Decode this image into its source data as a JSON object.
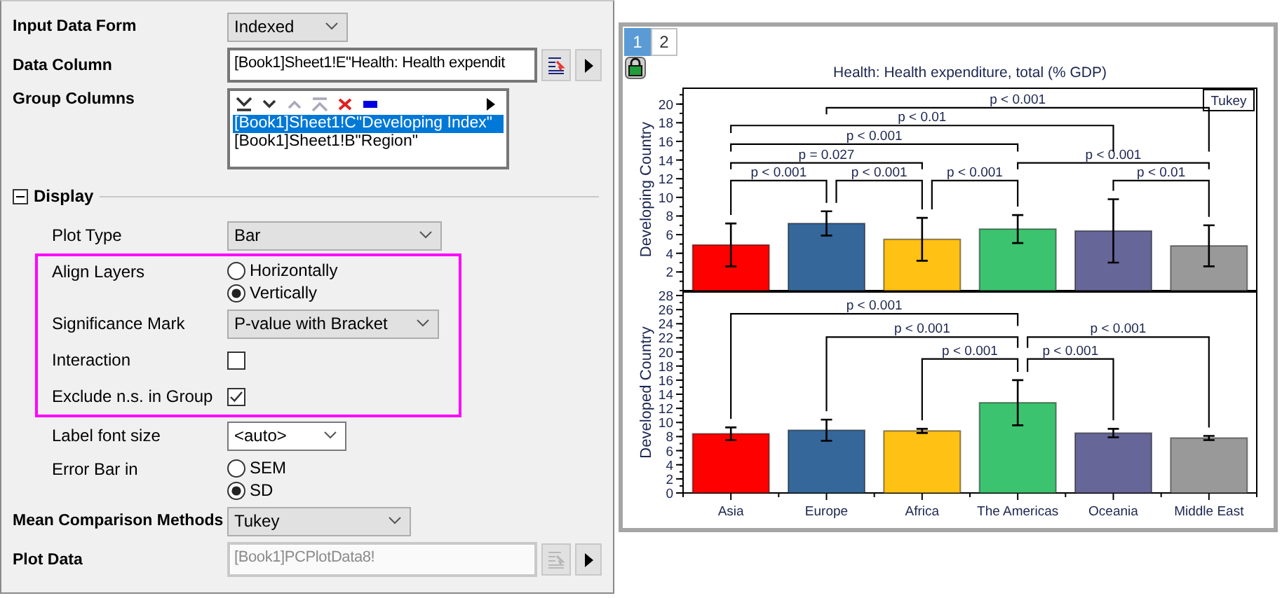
{
  "settings": [
    {
      "kind": "dropdown",
      "label": "Input Data Form",
      "value": "Indexed",
      "editable": false
    },
    {
      "kind": "field",
      "label": "Data Column",
      "value": "[Book1]Sheet1!E\"Health: Health expendit",
      "disabled": false
    },
    {
      "kind": "list",
      "label": "Group Columns",
      "tools": [
        {
          "kind": "bottom",
          "disabled": false
        },
        {
          "kind": "down",
          "disabled": false
        },
        {
          "kind": "up",
          "disabled": true
        },
        {
          "kind": "top",
          "disabled": true
        },
        {
          "kind": "delete",
          "disabled": false
        },
        {
          "kind": "rect",
          "disabled": false
        },
        {
          "kind": "more",
          "disabled": false
        }
      ],
      "items": [
        {
          "label": "[Book1]Sheet1!C\"Developing Index\"",
          "selected": true
        },
        {
          "label": "[Book1]Sheet1!B\"Region\"",
          "selected": false
        }
      ]
    },
    {
      "kind": "section",
      "label": "Display",
      "expanded": true,
      "children": [
        {
          "kind": "dropdown",
          "label": "Plot Type",
          "value": "Bar",
          "editable": false
        },
        {
          "kind": "group",
          "highlighted": true,
          "children": [
            {
              "kind": "radio",
              "label": "Align Layers",
              "options": [
                {
                  "label": "Horizontally",
                  "selected": false
                },
                {
                  "label": "Vertically",
                  "selected": true
                }
              ]
            },
            {
              "kind": "dropdown",
              "label": "Significance Mark",
              "value": "P-value with Bracket",
              "editable": false
            },
            {
              "kind": "checkbox",
              "label": "Interaction",
              "checked": false
            },
            {
              "kind": "checkbox",
              "label": "Exclude n.s. in Group",
              "checked": true
            }
          ]
        },
        {
          "kind": "dropdown",
          "label": "Label font size",
          "value": "<auto>",
          "editable": true
        },
        {
          "kind": "radio",
          "label": "Error Bar in",
          "options": [
            {
              "label": "SEM",
              "selected": false
            },
            {
              "label": "SD",
              "selected": true
            }
          ]
        }
      ]
    },
    {
      "kind": "dropdown",
      "label": "Mean Comparison Methods",
      "value": "Tukey",
      "editable": false
    },
    {
      "kind": "field",
      "label": "Plot Data",
      "value": "[Book1]PCPlotData8!",
      "disabled": true
    }
  ],
  "graph": {
    "tabs": [
      {
        "label": "1",
        "selected": true
      },
      {
        "label": "2",
        "selected": false
      }
    ],
    "charts": [
      {
        "legend": "Tukey",
        "chart_data": {
          "type": "bar",
          "title": "Health: Health expenditure, total (% GDP)",
          "ylabel": "Developing Country",
          "ylim": [
            0,
            21.7
          ],
          "yticks": [
            2,
            4,
            6,
            8,
            10,
            12,
            14,
            16,
            18,
            20
          ],
          "series": [
            {
              "values": [
                4.9,
                7.2,
                5.5,
                6.6,
                6.4,
                4.8
              ],
              "errors": [
                2.3,
                1.3,
                2.3,
                1.5,
                3.4,
                2.2
              ],
              "colors": [
                "#ff0000",
                "#35679a",
                "#ffc114",
                "#3cc36f",
                "#666699",
                "#999999"
              ]
            }
          ],
          "annotations": [
            "p < 0.001",
            "p < 0.01",
            "p < 0.001",
            "p = 0.027",
            "p < 0.001",
            "p < 0.001",
            "p < 0.001",
            "p < 0.001",
            "p < 0.01"
          ]
        }
      },
      {
        "chart_data": {
          "type": "bar",
          "ylabel": "Developed Country",
          "categories": [
            "Asia",
            "Europe",
            "Africa",
            "The Americas",
            "Oceania",
            "Middle East"
          ],
          "ylim": [
            0,
            28.5
          ],
          "yticks": [
            0,
            2,
            4,
            6,
            8,
            10,
            12,
            14,
            16,
            18,
            20,
            22,
            24,
            26,
            28
          ],
          "series": [
            {
              "values": [
                8.4,
                8.9,
                8.8,
                12.8,
                8.5,
                7.8
              ],
              "errors": [
                0.9,
                1.5,
                0.3,
                3.2,
                0.6,
                0.3
              ],
              "colors": [
                "#ff0000",
                "#35679a",
                "#ffc114",
                "#3cc36f",
                "#666699",
                "#999999"
              ]
            }
          ],
          "annotations": [
            "p < 0.001",
            "p < 0.001",
            "p < 0.001",
            "p < 0.001",
            "p < 0.001"
          ]
        }
      }
    ]
  }
}
